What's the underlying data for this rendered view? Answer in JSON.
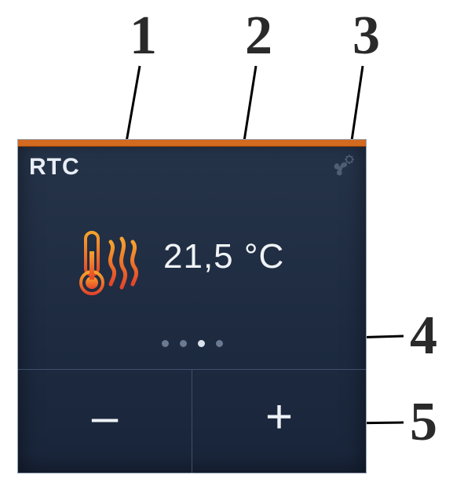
{
  "callouts": {
    "c1": "1",
    "c2": "2",
    "c3": "3",
    "c4": "4",
    "c5": "5"
  },
  "device": {
    "title": "RTC",
    "temperature": "21,5 °C",
    "fan_icon_name": "fan-gear-icon",
    "thermometer_icon_name": "thermometer-heat-icon",
    "pager_count": 4,
    "pager_active_index": 2,
    "minus_label": "–",
    "plus_label": "+"
  },
  "colors": {
    "accent": "#d26a1f",
    "panel_bg_top": "#26344a",
    "panel_bg_bottom": "#19253a",
    "text": "#eef2f7",
    "dot_inactive": "#6a7a92",
    "dot_active": "#d9e2ed"
  }
}
